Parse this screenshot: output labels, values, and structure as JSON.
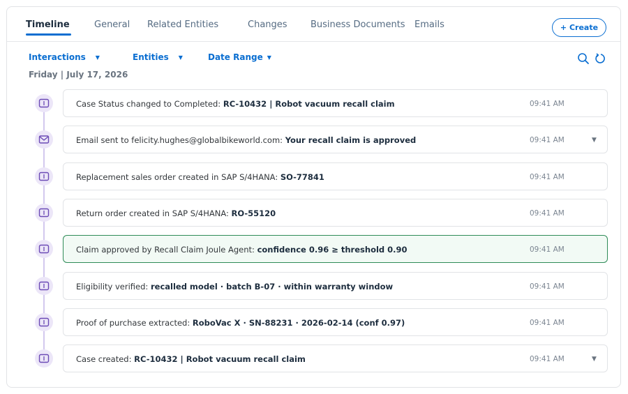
{
  "tabs": [
    {
      "label": "Timeline",
      "active": true
    },
    {
      "label": "General"
    },
    {
      "label": "Related Entities"
    },
    {
      "label": "Changes"
    },
    {
      "label": "Business Documents"
    },
    {
      "label": "Emails"
    }
  ],
  "create_label": "+ Create",
  "filters": {
    "interactions": "Interactions",
    "entities": "Entities",
    "date_range": "Date Range",
    "caret": "▼"
  },
  "date_header": "Friday | July 17, 2026",
  "icons": {
    "search": "search-icon",
    "refresh": "refresh-icon",
    "task": "task-icon",
    "email": "email-icon",
    "expand": "chevron-down-icon"
  },
  "colors": {
    "accent": "#0a6ed1",
    "timeline_node": "#ece6f8",
    "node_icon": "#6b4ab5",
    "highlight_border": "#2e8b57",
    "highlight_bg": "#f2faf5"
  },
  "timeline": [
    {
      "prefix": "Case Status changed to Completed: ",
      "bold": "RC-10432 | Robot vacuum recall claim",
      "time": "09:41 AM",
      "icon": "task-icon"
    },
    {
      "prefix": "Email sent to felicity.hughes@globalbikeworld.com: ",
      "bold": "Your recall claim is approved",
      "time": "09:41 AM",
      "icon": "email-icon",
      "expandable": true
    },
    {
      "prefix": "Replacement sales order created in SAP S/4HANA: ",
      "bold": "SO-77841",
      "time": "09:41 AM",
      "icon": "task-icon"
    },
    {
      "prefix": "Return order created in SAP S/4HANA: ",
      "bold": "RO-55120",
      "time": "09:41 AM",
      "icon": "task-icon"
    },
    {
      "prefix": "Claim approved by Recall Claim Joule Agent: ",
      "bold": "confidence 0.96 ≥ threshold 0.90",
      "time": "09:41 AM",
      "icon": "task-icon",
      "highlighted": true
    },
    {
      "prefix": "Eligibility verified: ",
      "bold": "recalled model · batch B-07 · within warranty window",
      "time": "09:41 AM",
      "icon": "task-icon"
    },
    {
      "prefix": "Proof of purchase extracted: ",
      "bold": "RoboVac X · SN-88231 · 2026-02-14 (conf 0.97)",
      "time": "09:41 AM",
      "icon": "task-icon"
    },
    {
      "prefix": "Case created: ",
      "bold": "RC-10432 | Robot vacuum recall claim",
      "time": "09:41 AM",
      "icon": "task-icon",
      "expandable": true
    }
  ]
}
